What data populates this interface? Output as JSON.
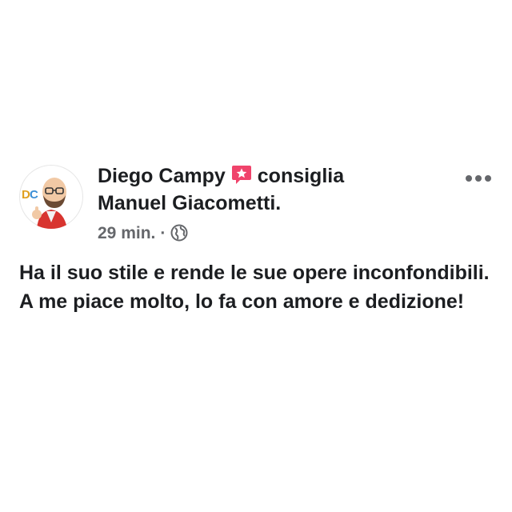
{
  "post": {
    "author": "Diego Campy",
    "verb": "consiglia",
    "recommended_page": "Manuel Giacometti.",
    "timestamp": "29 min.",
    "separator": "·",
    "privacy_icon": "globe-icon",
    "recommend_icon": "recommend-star-icon",
    "more_icon": "more-options-icon",
    "text": "Ha il suo stile e rende le sue opere inconfondibili. A me piace molto, lo fa con amore e dedizione!",
    "avatar_badge": "DC"
  },
  "colors": {
    "text": "#1c1e21",
    "secondary_text": "#65676b",
    "recommend_badge": "#f0436b",
    "icon_gray": "#65676b"
  }
}
